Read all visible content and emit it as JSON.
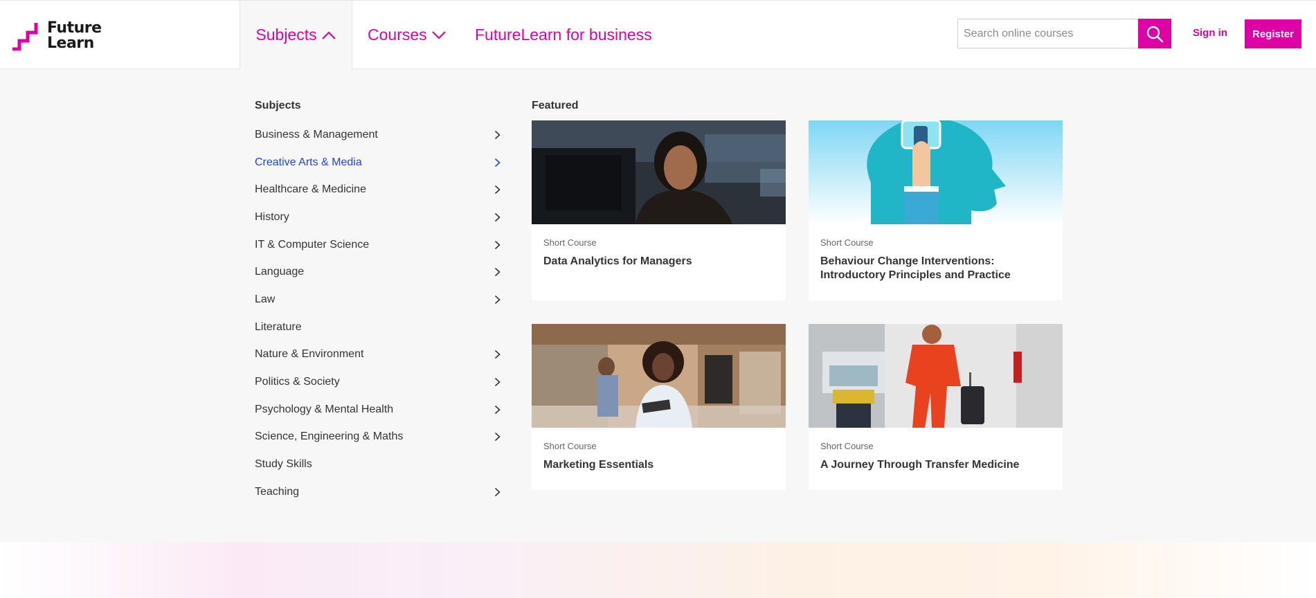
{
  "logo": {
    "line1": "Future",
    "line2": "Learn"
  },
  "nav": {
    "subjects": "Subjects",
    "courses": "Courses",
    "business": "FutureLearn for business"
  },
  "search": {
    "placeholder": "Search online courses"
  },
  "auth": {
    "signin": "Sign in",
    "register": "Register"
  },
  "menu": {
    "subjects_heading": "Subjects",
    "featured_heading": "Featured",
    "subjects": [
      {
        "label": "Business & Management",
        "has_arrow": true,
        "active": false
      },
      {
        "label": "Creative Arts & Media",
        "has_arrow": true,
        "active": true
      },
      {
        "label": "Healthcare & Medicine",
        "has_arrow": true,
        "active": false
      },
      {
        "label": "History",
        "has_arrow": true,
        "active": false
      },
      {
        "label": "IT & Computer Science",
        "has_arrow": true,
        "active": false
      },
      {
        "label": "Language",
        "has_arrow": true,
        "active": false
      },
      {
        "label": "Law",
        "has_arrow": true,
        "active": false
      },
      {
        "label": "Literature",
        "has_arrow": false,
        "active": false
      },
      {
        "label": "Nature & Environment",
        "has_arrow": true,
        "active": false
      },
      {
        "label": "Politics & Society",
        "has_arrow": true,
        "active": false
      },
      {
        "label": "Psychology & Mental Health",
        "has_arrow": true,
        "active": false
      },
      {
        "label": "Science, Engineering & Maths",
        "has_arrow": true,
        "active": false
      },
      {
        "label": "Study Skills",
        "has_arrow": false,
        "active": false
      },
      {
        "label": "Teaching",
        "has_arrow": true,
        "active": false
      }
    ],
    "featured": [
      {
        "kind": "Short Course",
        "title": "Data Analytics for Managers"
      },
      {
        "kind": "Short Course",
        "title": "Behaviour Change Interventions: Introductory Principles and Practice"
      },
      {
        "kind": "Short Course",
        "title": "Marketing Essentials"
      },
      {
        "kind": "Short Course",
        "title": "A Journey Through Transfer Medicine"
      }
    ]
  },
  "colors": {
    "brand": "#de00a5",
    "active_link": "#1c46e0",
    "panel_bg": "#f7f7f7"
  }
}
